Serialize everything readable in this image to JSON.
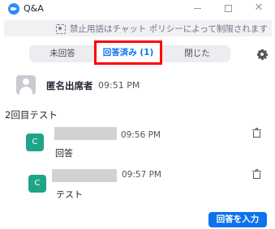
{
  "window": {
    "title": "Q&A",
    "minimize_label": "",
    "maximize_label": "",
    "close_label": "✕"
  },
  "policy": {
    "text": "禁止用語はチャット ポリシーによって制限されます"
  },
  "tabs": [
    {
      "label": "未回答"
    },
    {
      "label": "回答済み (1)"
    },
    {
      "label": "閉じた"
    }
  ],
  "question": {
    "author": "匿名出席者",
    "time": "09:51 PM",
    "text": "2回目テスト"
  },
  "answers": [
    {
      "avatar_letter": "C",
      "time": "09:56 PM",
      "text": "回答"
    },
    {
      "avatar_letter": "C",
      "time": "09:57 PM",
      "text": "テスト"
    }
  ],
  "answer_button": {
    "label": "回答を入力"
  },
  "colors": {
    "accent": "#0e72ed",
    "avatar_green": "#1ea587",
    "highlight": "#ff0000"
  }
}
